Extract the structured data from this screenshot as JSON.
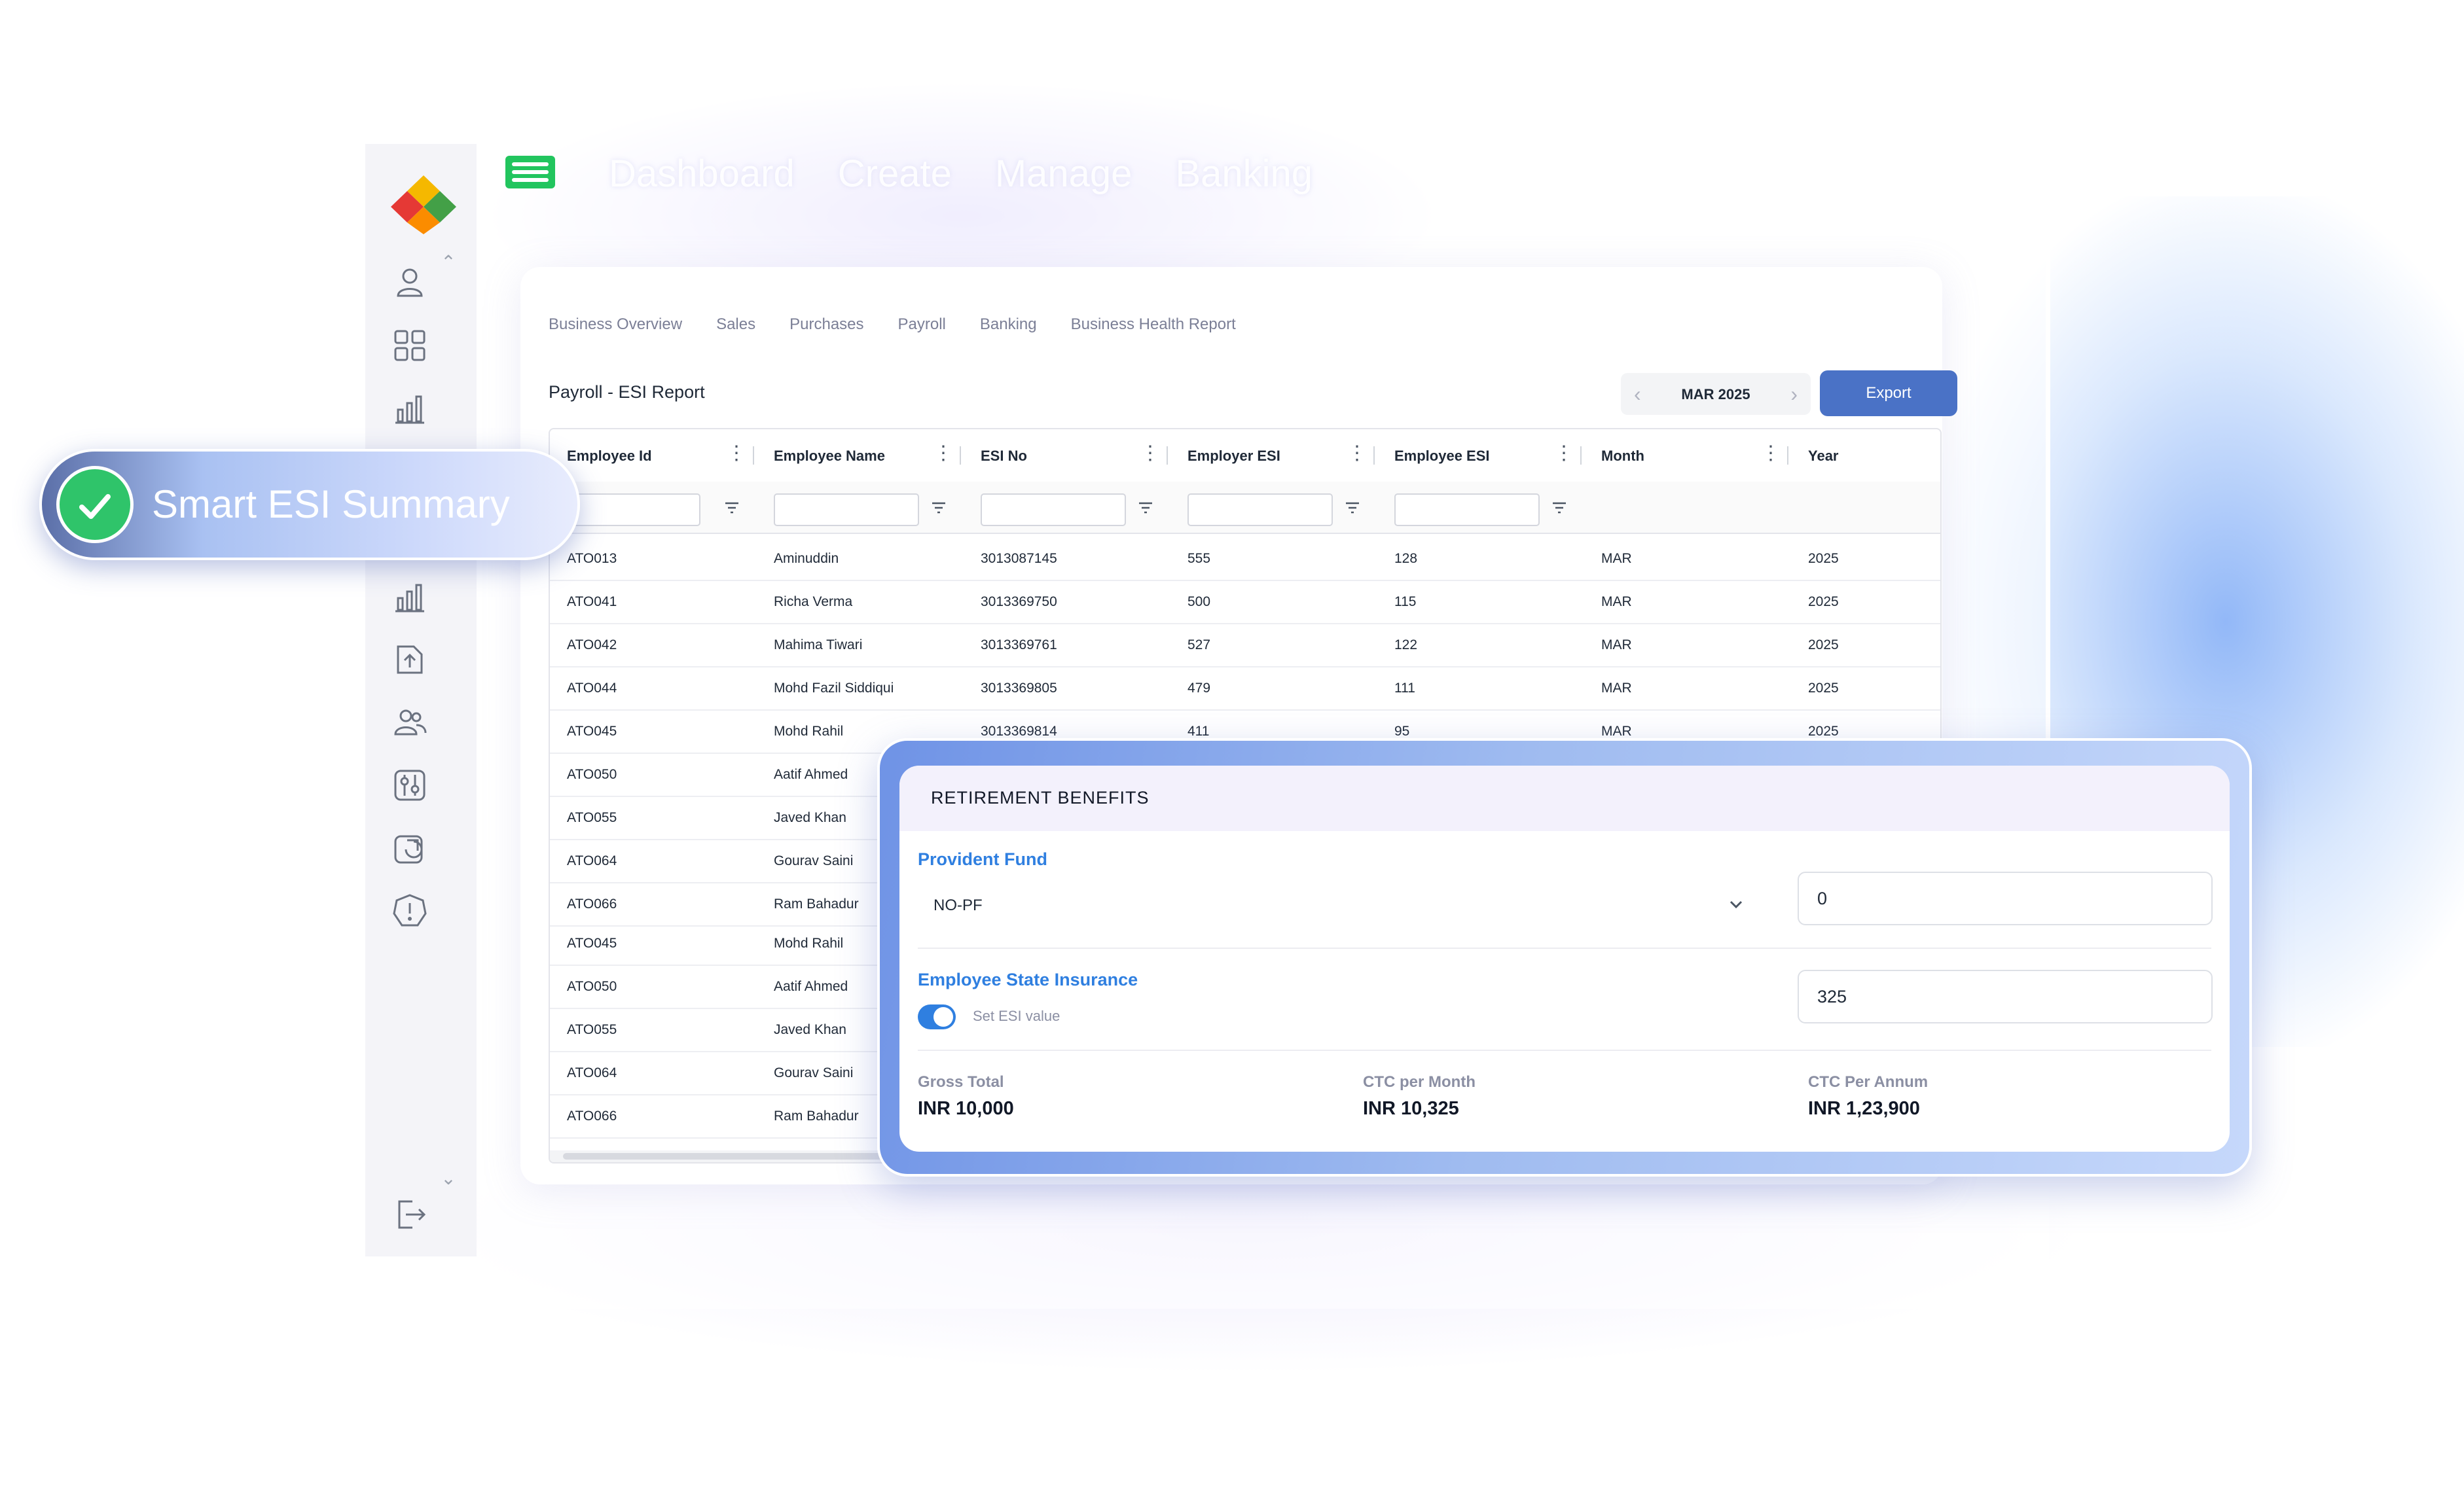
{
  "top_nav": {
    "items": [
      "Dashboard",
      "Create",
      "Manage",
      "Banking"
    ]
  },
  "sidebar": {
    "icons": [
      "user-icon",
      "grid-icon",
      "bar-chart-icon",
      "bar-chart-icon",
      "upload-file-icon",
      "users-icon",
      "sliders-icon",
      "pie-report-icon",
      "alert-icon",
      "logout-icon"
    ]
  },
  "tabs": [
    "Business Overview",
    "Sales",
    "Purchases",
    "Payroll",
    "Banking",
    "Business Health Report"
  ],
  "page_title": "Payroll - ESI Report",
  "period": {
    "label": "MAR 2025",
    "prev_icon": "chevron-left-icon",
    "next_icon": "chevron-right-icon"
  },
  "export_label": "Export",
  "table": {
    "columns": [
      "Employee Id",
      "Employee Name",
      "ESI No",
      "Employer ESI",
      "Employee ESI",
      "Month",
      "Year"
    ],
    "rows": [
      [
        "ATO013",
        "Aminuddin",
        "3013087145",
        "555",
        "128",
        "MAR",
        "2025"
      ],
      [
        "ATO041",
        "Richa Verma",
        "3013369750",
        "500",
        "115",
        "MAR",
        "2025"
      ],
      [
        "ATO042",
        "Mahima Tiwari",
        "3013369761",
        "527",
        "122",
        "MAR",
        "2025"
      ],
      [
        "ATO044",
        "Mohd Fazil Siddiqui",
        "3013369805",
        "479",
        "111",
        "MAR",
        "2025"
      ],
      [
        "ATO045",
        "Mohd Rahil",
        "3013369814",
        "411",
        "95",
        "MAR",
        "2025"
      ],
      [
        "ATO050",
        "Aatif Ahmed",
        "",
        "",
        "",
        "",
        ""
      ],
      [
        "ATO055",
        "Javed Khan",
        "",
        "",
        "",
        "",
        ""
      ],
      [
        "ATO064",
        "Gourav Saini",
        "",
        "",
        "",
        "",
        ""
      ],
      [
        "ATO066",
        "Ram Bahadur",
        "",
        "",
        "",
        "",
        ""
      ],
      [
        "ATO045",
        "Mohd Rahil",
        "",
        "",
        "",
        "",
        ""
      ],
      [
        "ATO050",
        "Aatif Ahmed",
        "",
        "",
        "",
        "",
        ""
      ],
      [
        "ATO055",
        "Javed Khan",
        "",
        "",
        "",
        "",
        ""
      ],
      [
        "ATO064",
        "Gourav Saini",
        "",
        "",
        "",
        "",
        ""
      ],
      [
        "ATO066",
        "Ram Bahadur",
        "",
        "",
        "",
        "",
        ""
      ]
    ]
  },
  "retirement": {
    "title": "RETIREMENT BENEFITS",
    "pf_label": "Provident Fund",
    "pf_selected": "NO-PF",
    "pf_value": "0",
    "esi_label": "Employee State Insurance",
    "esi_toggle_label": "Set ESI value",
    "esi_toggle_on": true,
    "esi_value": "325",
    "gross_total_label": "Gross Total",
    "gross_total_value": "INR 10,000",
    "ctc_month_label": "CTC per Month",
    "ctc_month_value": "INR 10,325",
    "ctc_annum_label": "CTC Per Annum",
    "ctc_annum_value": "INR 1,23,900"
  },
  "badge": {
    "text": "Smart ESI Summary"
  },
  "colors": {
    "accent": "#2f7fe0",
    "export_button": "#4a72c6",
    "badge_check": "#2fc46a",
    "hamburger": "#22c55e"
  }
}
